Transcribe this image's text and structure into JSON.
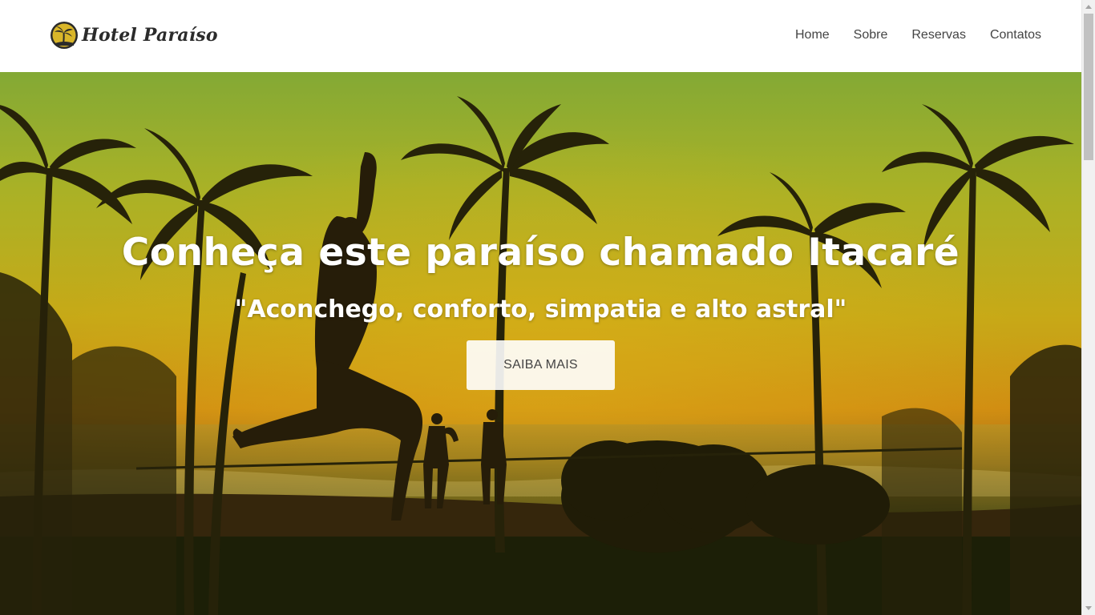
{
  "header": {
    "logo_text": "Hotel Paraíso",
    "nav": [
      {
        "label": "Home"
      },
      {
        "label": "Sobre"
      },
      {
        "label": "Reservas"
      },
      {
        "label": "Contatos"
      }
    ]
  },
  "hero": {
    "title": "Conheça este paraíso chamado Itacaré",
    "subtitle": "\"Aconchego, conforto, simpatia e alto astral\"",
    "cta_label": "SAIBA MAIS"
  },
  "colors": {
    "sky_top": "#8fb83a",
    "sky_mid": "#d8c21a",
    "horizon": "#e39a14",
    "ground": "#1f2208",
    "nav_text": "#444444"
  },
  "icons": {
    "logo": "palm-tree-logo-icon",
    "scroll_up": "chevron-up-icon",
    "scroll_down": "chevron-down-icon"
  }
}
